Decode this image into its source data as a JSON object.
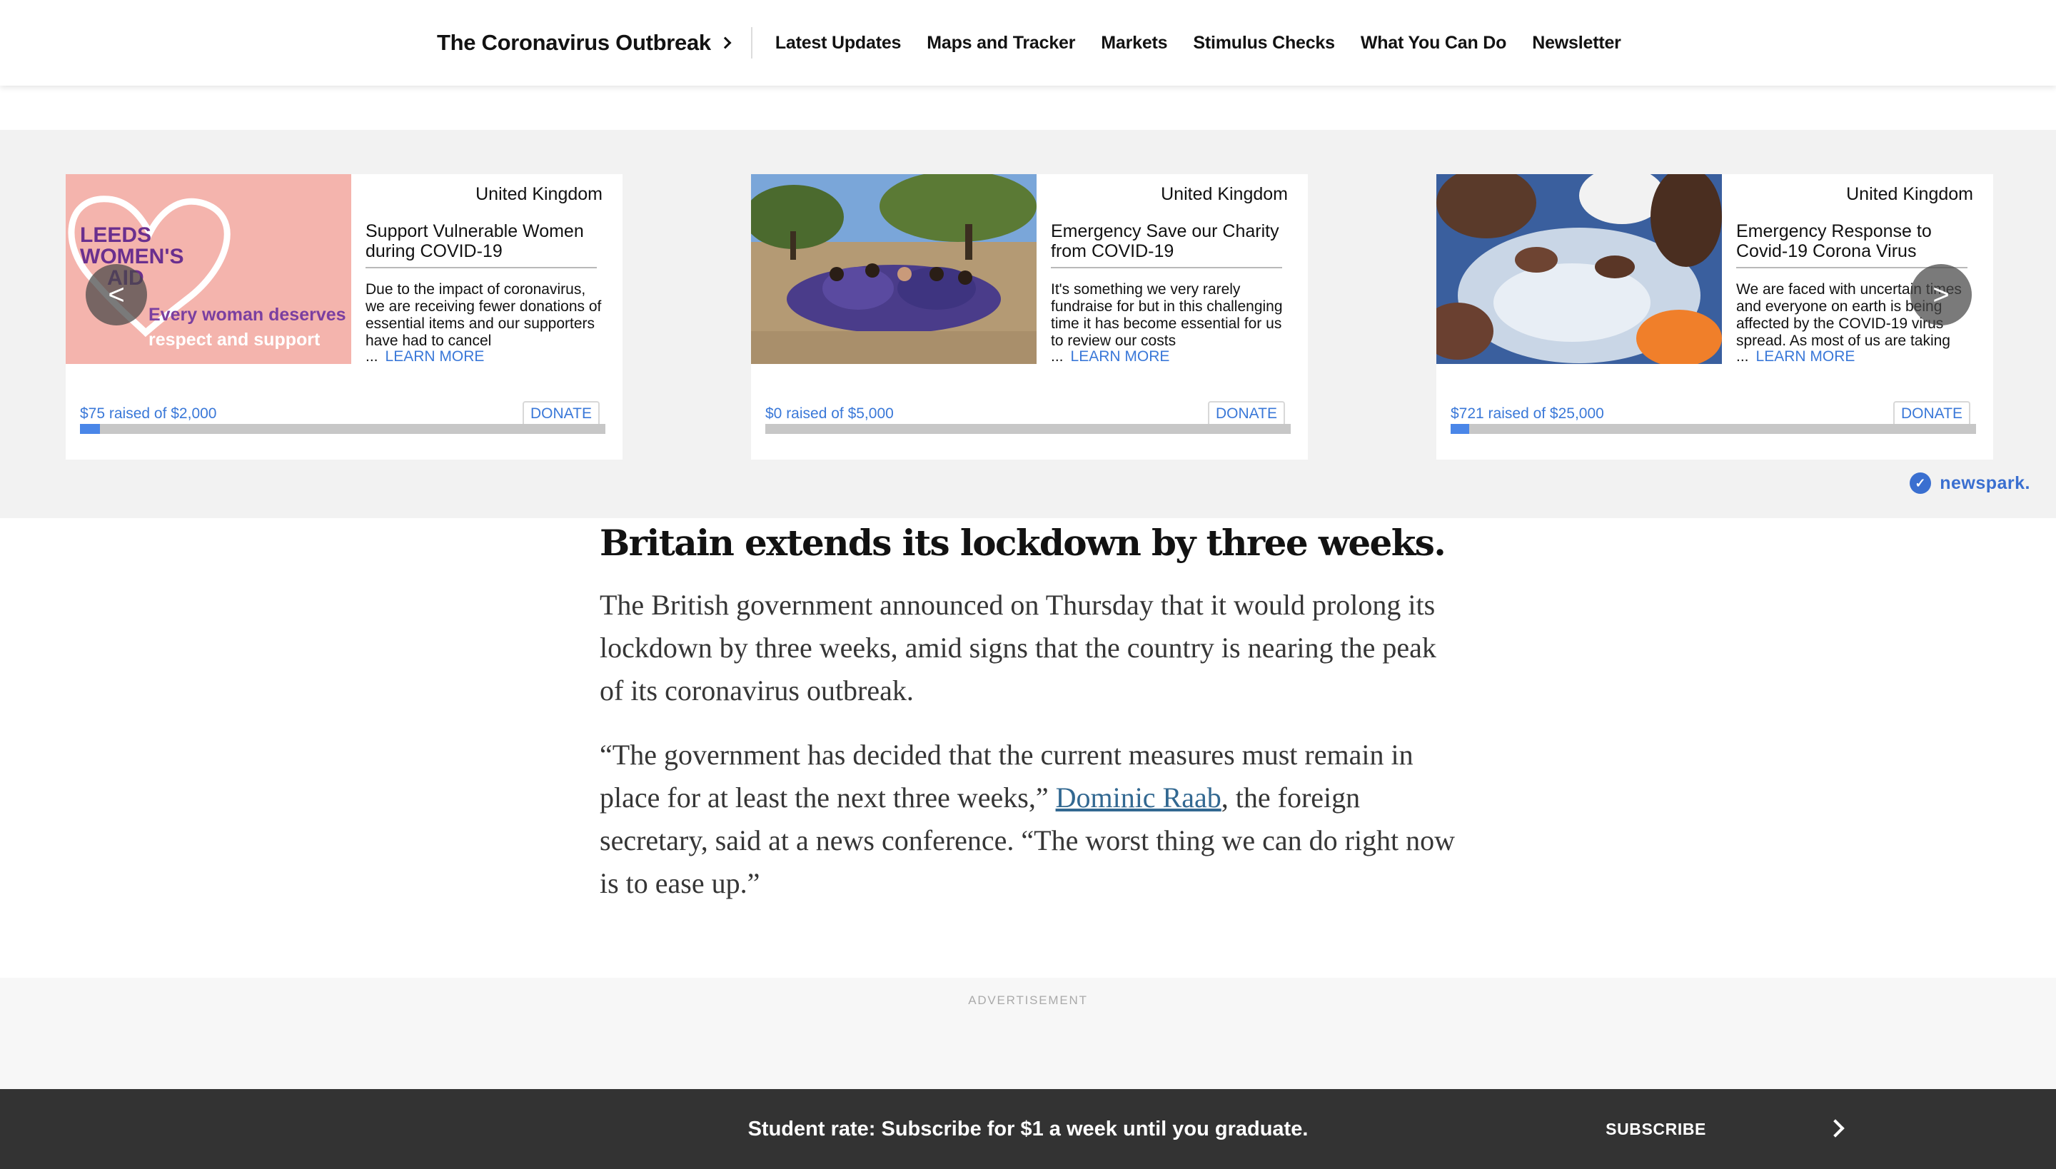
{
  "nav": {
    "title": "The Coronavirus Outbreak",
    "links": [
      "Latest Updates",
      "Maps and Tracker",
      "Markets",
      "Stimulus Checks",
      "What You Can Do",
      "Newsletter"
    ]
  },
  "carousel": {
    "cards": [
      {
        "region": "United Kingdom",
        "title": "Support Vulnerable Women during COVID-19",
        "description": "Due to the impact of coronavirus, we are receiving fewer donations of essential items and our supporters have had to cancel",
        "ellipsis": "...",
        "learn_more": "LEARN MORE",
        "raised": "$75 raised of $2,000",
        "donate": "DONATE",
        "progress": 0.0375,
        "image_text": {
          "logo_line1": "LEEDS",
          "logo_line2": "WOMEN'S",
          "logo_line3": "AID",
          "tagline1": "Every woman deserves",
          "tagline2": "respect and support"
        }
      },
      {
        "region": "United Kingdom",
        "title": "Emergency Save our Charity from COVID-19",
        "description": "It's something we very rarely fundraise for but in this challenging time it has become essential for us to review our costs",
        "ellipsis": "...",
        "learn_more": "LEARN MORE",
        "raised": "$0 raised of $5,000",
        "donate": "DONATE",
        "progress": 0.0
      },
      {
        "region": "United Kingdom",
        "title": "Emergency Response to Covid-19 Corona Virus",
        "description": "We are faced with uncertain times and everyone on earth is being affected by the COVID-19 virus spread. As most of us are taking",
        "ellipsis": "...",
        "learn_more": "LEARN MORE",
        "raised": "$721 raised of $25,000",
        "donate": "DONATE",
        "progress": 0.0288
      }
    ],
    "prev_arrow": "<",
    "next_arrow": ">",
    "brand": "newspark."
  },
  "article": {
    "headline": "Britain extends its lockdown by three weeks.",
    "para1": "The British government announced on Thursday that it would prolong its lockdown by three weeks, amid signs that the country is nearing the peak of its coronavirus outbreak.",
    "para2_before": "“The government has decided that the current measures must remain in place for at least the next three weeks,” ",
    "para2_link": "Dominic Raab",
    "para2_after": ", the foreign secretary, said at a news conference. “The worst thing we can do right now is to ease up.”"
  },
  "ad": {
    "label": "ADVERTISEMENT"
  },
  "footer": {
    "promo": "Student rate: Subscribe for $1 a week until you graduate.",
    "subscribe": "SUBSCRIBE"
  },
  "colors": {
    "link_blue": "#3a78d8",
    "article_link": "#326891",
    "progress_fill": "#4a86e8",
    "footer_bg": "#333333",
    "logo_purple": "#6a2f8e",
    "logo_pink_bg": "#f4b4ad"
  }
}
